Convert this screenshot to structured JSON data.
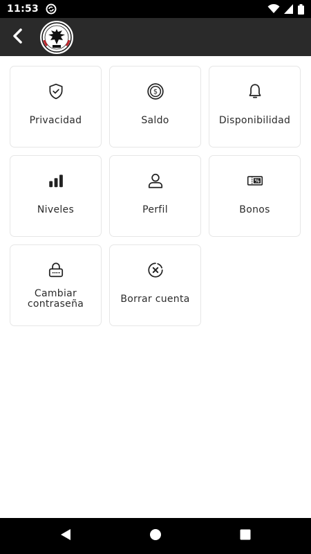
{
  "status_bar": {
    "time": "11:53",
    "icons": [
      "sync-icon",
      "wifi-icon",
      "signal-icon",
      "battery-icon"
    ]
  },
  "app_bar": {
    "back_icon": "back-arrow-icon",
    "logo": "eagle-crest-logo"
  },
  "tiles": [
    {
      "label": "Privacidad",
      "icon": "shield-check-icon"
    },
    {
      "label": "Saldo",
      "icon": "coin-dollar-icon"
    },
    {
      "label": "Disponibilidad",
      "icon": "bell-icon"
    },
    {
      "label": "Niveles",
      "icon": "bar-levels-icon"
    },
    {
      "label": "Perfil",
      "icon": "user-icon"
    },
    {
      "label": "Bonos",
      "icon": "voucher-percent-icon"
    },
    {
      "label": "Cambiar contraseña",
      "icon": "lock-password-icon"
    },
    {
      "label": "Borrar cuenta",
      "icon": "delete-circle-icon"
    }
  ],
  "nav_bar": {
    "buttons": [
      "back-triangle-icon",
      "home-circle-icon",
      "recents-square-icon"
    ]
  },
  "colors": {
    "status_bar": "#000000",
    "app_bar": "#2a2a2a",
    "tile_border": "#e6e6e6",
    "text": "#2b2b2b"
  }
}
